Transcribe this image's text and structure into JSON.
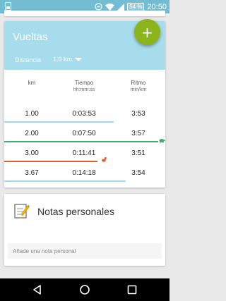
{
  "status_bar": {
    "battery": "54 %",
    "time": "20:50",
    "icons": [
      "notification-icon",
      "do-not-disturb-icon",
      "wifi-icon",
      "signal-icon",
      "battery-icon"
    ]
  },
  "laps": {
    "title": "Vueltas",
    "distance_label": "Distancia",
    "distance_value": "1.0 km",
    "columns": {
      "km": "km",
      "time": "Tiempo",
      "time_unit": "hh:mm:ss",
      "pace": "Ritmo",
      "pace_unit": "min/km"
    },
    "rows": [
      {
        "km": "1.00",
        "time": "0:03:53",
        "pace": "3:53",
        "bar_color": "#9fd8ea",
        "indicator": null
      },
      {
        "km": "2.00",
        "time": "0:07:50",
        "pace": "3:57",
        "bar_color": "#3fae6e",
        "indicator": "turtle-icon"
      },
      {
        "km": "3.00",
        "time": "0:11:41",
        "pace": "3:51",
        "bar_color": "#e35b2e",
        "indicator": "rabbit-icon"
      },
      {
        "km": "3.67",
        "time": "0:14:18",
        "pace": "3:54",
        "bar_color": "#9fd8ea",
        "indicator": null
      }
    ]
  },
  "fab": {
    "icon": "plus-icon",
    "color": "#8bb51b"
  },
  "notes": {
    "title": "Notas personales",
    "placeholder": "Añade una nota personal"
  },
  "nav": {
    "buttons": [
      "back-icon",
      "home-icon",
      "recents-icon"
    ]
  },
  "colors": {
    "header": "#a6dcec",
    "status_bar": "#73bcd2",
    "accent_green": "#8bb51b"
  }
}
